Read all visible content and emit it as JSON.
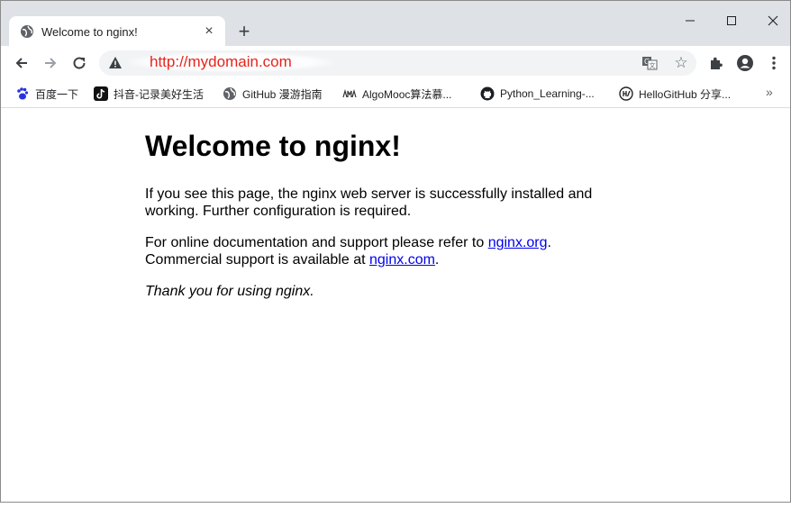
{
  "browser": {
    "tab": {
      "title": "Welcome to nginx!",
      "favicon": "globe-icon",
      "close": "×"
    },
    "new_tab": "+",
    "address": {
      "url": "http://mydomain.com",
      "url_color": "#e8231d"
    },
    "bookmarks": [
      {
        "label": "百度一下",
        "icon": "baidu-paw-icon"
      },
      {
        "label": "抖音-记录美好生活",
        "icon": "douyin-icon"
      },
      {
        "label": "GitHub 漫游指南",
        "icon": "globe-icon"
      },
      {
        "label": "AlgoMooc算法慕...",
        "icon": "algomooc-icon"
      },
      {
        "label": "Python_Learning-...",
        "icon": "github-icon"
      },
      {
        "label": "HelloGitHub 分享...",
        "icon": "hellogithub-icon"
      }
    ],
    "overflow": "»"
  },
  "page": {
    "heading": "Welcome to nginx!",
    "para1": "If you see this page, the nginx web server is successfully installed and working. Further configuration is required.",
    "para2_text1": "For online documentation and support please refer to ",
    "link_org": "nginx.org",
    "para2_text2": ".",
    "para2_text3": "Commercial support is available at ",
    "link_com": "nginx.com",
    "para2_text4": ".",
    "para3": "Thank you for using nginx.",
    "link_color": "#0000ee"
  }
}
